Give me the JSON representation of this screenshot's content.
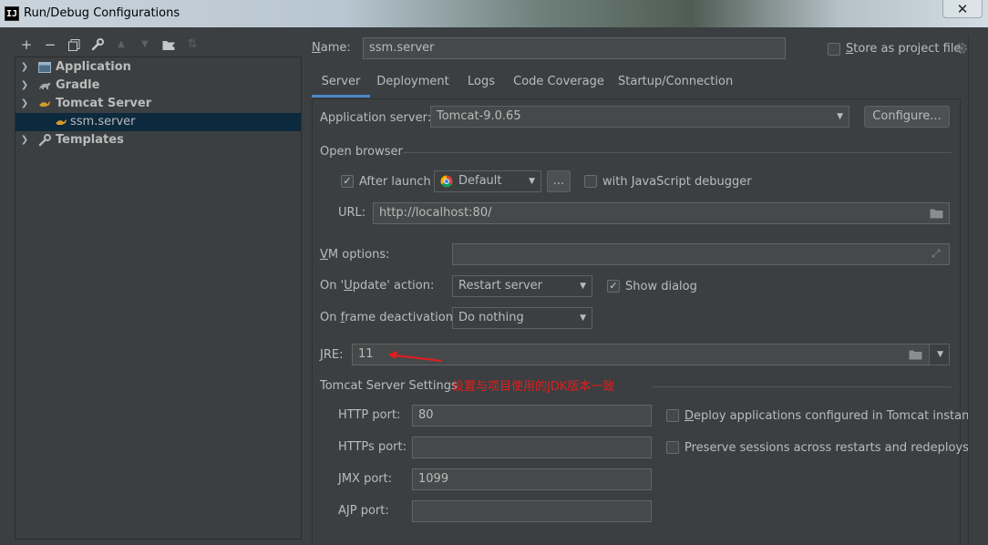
{
  "window": {
    "title": "Run/Debug Configurations",
    "app_icon_text": "IJ",
    "close_label": "✕"
  },
  "toolbar": {
    "add": "+",
    "remove": "−",
    "copy": "⧉",
    "edit_defaults": "🔧",
    "move_up": "▲",
    "move_down": "▼",
    "new_folder": "📁",
    "sort": "⇅"
  },
  "tree": {
    "items": [
      {
        "label": "Application",
        "expanded": false,
        "icon": "application-icon"
      },
      {
        "label": "Gradle",
        "expanded": false,
        "icon": "gradle-icon"
      },
      {
        "label": "Tomcat Server",
        "expanded": true,
        "icon": "tomcat-icon"
      },
      {
        "label": "ssm.server",
        "child": true,
        "selected": true,
        "icon": "tomcat-icon"
      },
      {
        "label": "Templates",
        "expanded": false,
        "icon": "wrench-icon"
      }
    ]
  },
  "config": {
    "name_label": "ame:",
    "name_mnemonic": "N",
    "name_value": "ssm.server",
    "store_as_project_label": "tore as project file",
    "store_as_project_mnemonic": "S",
    "store_as_project_checked": false
  },
  "tabs": [
    "Server",
    "Deployment",
    "Logs",
    "Code Coverage",
    "Startup/Connection"
  ],
  "active_tab": "Server",
  "server": {
    "app_server_label": "Application server:",
    "app_server_value": "Tomcat-9.0.65",
    "configure_label": "Configure...",
    "open_browser_label": "Open browser",
    "after_launch_label": "After launch",
    "after_launch_checked": true,
    "browser_value": "Default",
    "browser_more": "...",
    "js_debugger_label": "with JavaScript debugger",
    "js_debugger_checked": false,
    "url_label": "URL:",
    "url_value": "http://localhost:80/",
    "vm_options_label": "M options:",
    "vm_options_mnemonic": "V",
    "vm_options_value": "",
    "on_update_label_pre": "On '",
    "on_update_mnemonic": "U",
    "on_update_label_post": "pdate' action:",
    "on_update_value": "Restart server",
    "show_dialog_label": "Show dialog",
    "show_dialog_checked": true,
    "on_frame_label_pre": "On ",
    "on_frame_mnemonic": "f",
    "on_frame_label_post": "rame deactivation:",
    "on_frame_value": "Do nothing",
    "jre_label": "RE:",
    "jre_mnemonic": "J",
    "jre_value": "11",
    "annotation_text": "设置与项目使用的JDK版本一致",
    "annotation_color": "#e81b1b",
    "tomcat_settings_label": "Tomcat Server Settings",
    "http_port_label": "HTTP port:",
    "http_port_value": "80",
    "https_port_label": "HTTPs port:",
    "https_port_value": "",
    "jmx_port_label": "JMX port:",
    "jmx_port_value": "1099",
    "ajp_port_label": "AJP port:",
    "ajp_port_value": "",
    "deploy_apps_label": "eploy applications configured in Tomcat instance",
    "deploy_apps_mnemonic": "D",
    "deploy_apps_checked": false,
    "preserve_sessions_label": "Preserve sessions across restarts and redeploys",
    "preserve_sessions_checked": false
  },
  "colors": {
    "background": "#3c3f41",
    "selection": "#0d293e",
    "tab_accent": "#4a88c7",
    "field_bg": "#45494a"
  }
}
